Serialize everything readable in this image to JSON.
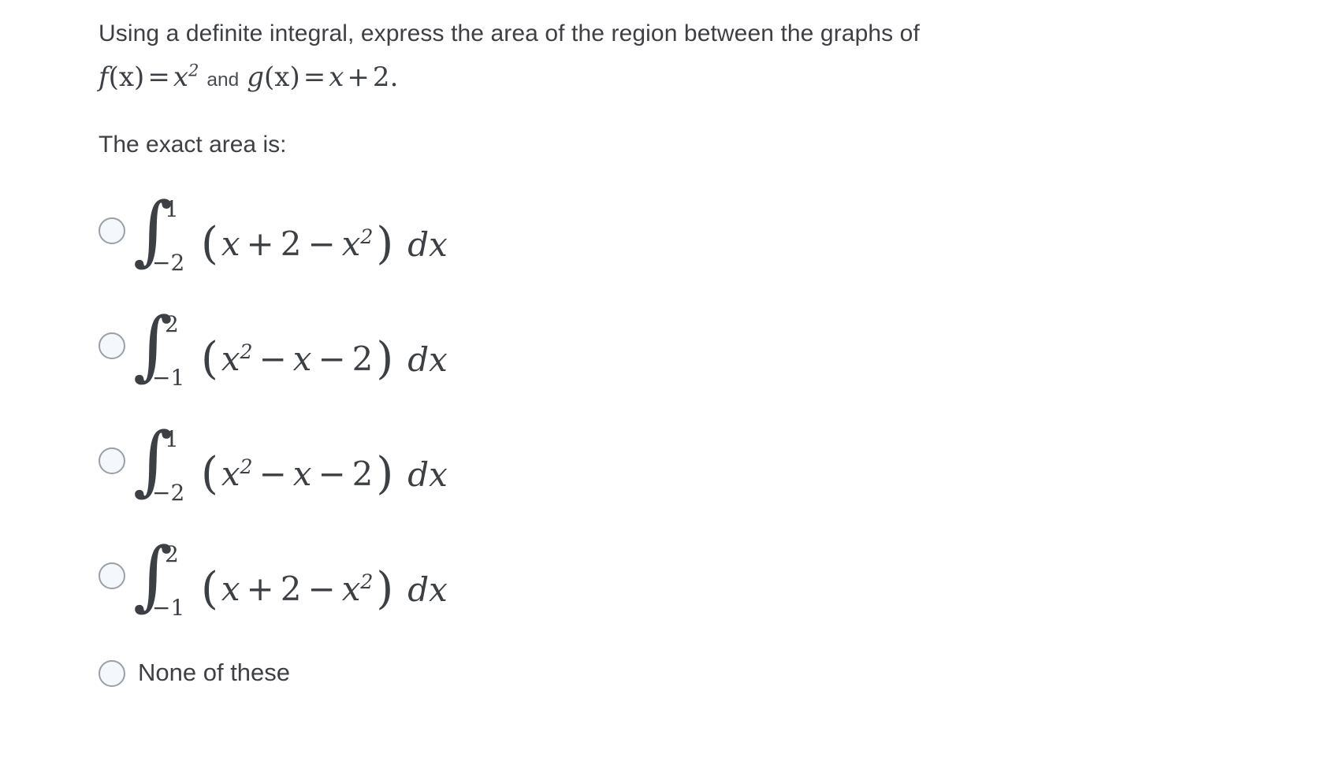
{
  "question": {
    "line1": "Using a definite integral, express the area of the region between the graphs of",
    "formula": {
      "f_name": "f",
      "f_arg": "(x)",
      "equals": "=",
      "f_body": "x",
      "f_exp": "2",
      "and": "and",
      "g_name": "g",
      "g_arg": "(x)",
      "g_body_x": "x",
      "g_plus": "+",
      "g_const": "2",
      "period": "."
    },
    "lead": "The exact area is:"
  },
  "options": [
    {
      "id": "option-a",
      "integral_symbol": "∫",
      "upper_limit": "1",
      "lower_limit": "−2",
      "open_paren": "(",
      "terms": [
        {
          "text": "x",
          "style": "var"
        },
        {
          "text": "+",
          "style": "sign"
        },
        {
          "text": "2",
          "style": "num"
        },
        {
          "text": "−",
          "style": "sign"
        },
        {
          "text": "x",
          "style": "var",
          "exp": "2"
        }
      ],
      "close_paren": ")",
      "differential": "dx",
      "selected": false
    },
    {
      "id": "option-b",
      "integral_symbol": "∫",
      "upper_limit": "2",
      "lower_limit": "−1",
      "open_paren": "(",
      "terms": [
        {
          "text": "x",
          "style": "var",
          "exp": "2"
        },
        {
          "text": "−",
          "style": "sign"
        },
        {
          "text": "x",
          "style": "var"
        },
        {
          "text": "−",
          "style": "sign"
        },
        {
          "text": "2",
          "style": "num"
        }
      ],
      "close_paren": ")",
      "differential": "dx",
      "selected": false
    },
    {
      "id": "option-c",
      "integral_symbol": "∫",
      "upper_limit": "1",
      "lower_limit": "−2",
      "open_paren": "(",
      "terms": [
        {
          "text": "x",
          "style": "var",
          "exp": "2"
        },
        {
          "text": "−",
          "style": "sign"
        },
        {
          "text": "x",
          "style": "var"
        },
        {
          "text": "−",
          "style": "sign"
        },
        {
          "text": "2",
          "style": "num"
        }
      ],
      "close_paren": ")",
      "differential": "dx",
      "selected": false
    },
    {
      "id": "option-d",
      "integral_symbol": "∫",
      "upper_limit": "2",
      "lower_limit": "−1",
      "open_paren": "(",
      "terms": [
        {
          "text": "x",
          "style": "var"
        },
        {
          "text": "+",
          "style": "sign"
        },
        {
          "text": "2",
          "style": "num"
        },
        {
          "text": "−",
          "style": "sign"
        },
        {
          "text": "x",
          "style": "var",
          "exp": "2"
        }
      ],
      "close_paren": ")",
      "differential": "dx",
      "selected": false
    }
  ],
  "none_option": {
    "id": "option-none",
    "label": "None of these",
    "selected": false
  },
  "colors": {
    "text": "#3f4044",
    "math": "#3c3f43",
    "radio_border": "#9aa0a6",
    "radio_fill": "#f4f7fb",
    "background": "#ffffff"
  }
}
